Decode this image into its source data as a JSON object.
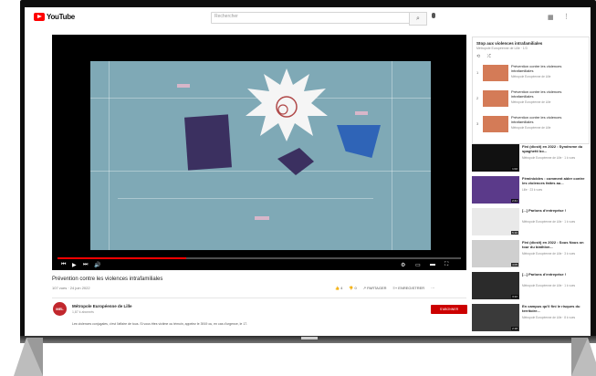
{
  "masthead": {
    "logo_text": "YouTube",
    "search_placeholder": "Rechercher"
  },
  "player": {
    "progress": 0.32
  },
  "video": {
    "title": "Prévention contre les violences intrafamiliales",
    "meta": "107 vues · 24 juin 2022",
    "likes": "4",
    "dislikes": "0",
    "share_label": "PARTAGER",
    "save_label": "ENREGISTRER"
  },
  "channel": {
    "name": "Métropole Européenne de Lille",
    "avatar_text": "MEL",
    "subscribers": "1,87 k abonnés",
    "subscribe_label": "S'ABONNER",
    "description": "Les violences conjugales, c'est l'affaire de tous. Si vous êtes victime ou témoin, appelez le 3919 ou, en cas d'urgence, le 17."
  },
  "playlist": {
    "title": "Stop aux violences intrafamiliales",
    "subtitle": "Métropole Européenne de Lille · 1/3",
    "items": [
      {
        "index": "1",
        "title": "Prévention contre les violences intrafamiliales",
        "channel": "Métropole Européenne de Lille"
      },
      {
        "index": "2",
        "title": "Prévention contre les violences intrafamiliales",
        "channel": "Métropole Européenne de Lille"
      },
      {
        "index": "3",
        "title": "Prévention contre les violences intrafamiliales",
        "channel": "Métropole Européenne de Lille"
      }
    ]
  },
  "recommendations": [
    {
      "title": "Fini (dicsit) en 2022 : Syndrome du spaghetti bo...",
      "channel": "Métropole Européenne de Lille · 1 k vues",
      "duration": "1:02"
    },
    {
      "title": "Féminicides : comment aider contre les violences faites au...",
      "channel": "Lille · 23 k vues",
      "duration": "2:41"
    },
    {
      "title": "[...] Parlons d'entreprise !",
      "channel": "Métropole Européenne de Lille · 1 k vues",
      "duration": "5:10"
    },
    {
      "title": "Fini (dicsit) en 2022 : Sous Nous on tour du biathlon...",
      "channel": "Métropole Européenne de Lille · 3 k vues",
      "duration": "4:05"
    },
    {
      "title": "[...] Parlons d'entreprise !",
      "channel": "Métropole Européenne de Lille · 1 k vues",
      "duration": "3:22"
    },
    {
      "title": "En campus qu'il fini le risques du territoire...",
      "channel": "Métropole Européenne de Lille · 8 k vues",
      "duration": "2:18"
    }
  ],
  "colors": {
    "brand_red": "#ff0000",
    "animation_bg": "#7fa9b6",
    "subscribe_red": "#cc0000"
  }
}
